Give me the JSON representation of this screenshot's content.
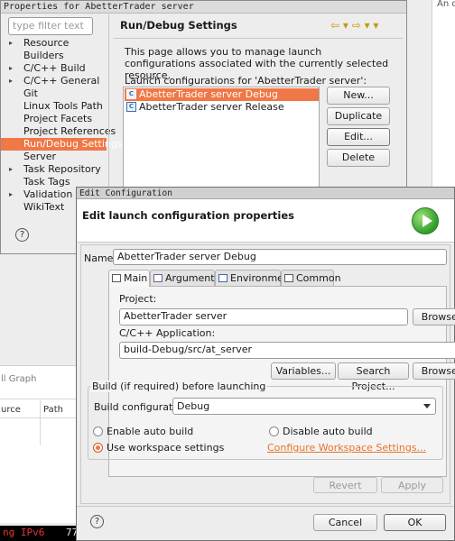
{
  "background": {
    "right_panel_text": "An o",
    "bottom_panel": {
      "title": "ll Graph",
      "columns": [
        "urce",
        "Path"
      ]
    },
    "terminal_text": "ng IPv6",
    "terminal_num": "77"
  },
  "properties": {
    "window_title": "Properties for AbetterTrader server",
    "filter_placeholder": "type filter text",
    "tree": [
      {
        "label": "Resource",
        "expandable": true,
        "selected": false
      },
      {
        "label": "Builders",
        "expandable": false,
        "selected": false
      },
      {
        "label": "C/C++ Build",
        "expandable": true,
        "selected": false
      },
      {
        "label": "C/C++ General",
        "expandable": true,
        "selected": false
      },
      {
        "label": "Git",
        "expandable": false,
        "selected": false
      },
      {
        "label": "Linux Tools Path",
        "expandable": false,
        "selected": false
      },
      {
        "label": "Project Facets",
        "expandable": false,
        "selected": false
      },
      {
        "label": "Project References",
        "expandable": false,
        "selected": false
      },
      {
        "label": "Run/Debug Settings",
        "expandable": false,
        "selected": true
      },
      {
        "label": "Server",
        "expandable": false,
        "selected": false
      },
      {
        "label": "Task Repository",
        "expandable": true,
        "selected": false
      },
      {
        "label": "Task Tags",
        "expandable": false,
        "selected": false
      },
      {
        "label": "Validation",
        "expandable": true,
        "selected": false
      },
      {
        "label": "WikiText",
        "expandable": false,
        "selected": false
      }
    ],
    "page_title": "Run/Debug Settings",
    "description": "This page allows you to manage launch configurations associated with the currently selected resource.",
    "launch_label": "Launch configurations for 'AbetterTrader server':",
    "configurations": [
      {
        "label": "AbetterTrader server Debug",
        "selected": true
      },
      {
        "label": "AbetterTrader server Release",
        "selected": false
      }
    ],
    "buttons": {
      "new": "New...",
      "duplicate": "Duplicate",
      "edit": "Edit...",
      "delete": "Delete"
    },
    "nav_icons": "⇦ ▾ ⇨ ▾ ▾"
  },
  "edit_dialog": {
    "window_title": "Edit Configuration",
    "header_title": "Edit launch configuration properties",
    "name_label": "Name:",
    "name_value": "AbetterTrader server Debug",
    "tabs": [
      "Main",
      "Arguments",
      "Environment",
      "Common"
    ],
    "active_tab": "Main",
    "project_label": "Project:",
    "project_value": "AbetterTrader server",
    "browse_label": "Browse...",
    "app_label": "C/C++ Application:",
    "app_value": "build-Debug/src/at_server",
    "variables_label": "Variables...",
    "search_project_label": "Search Project...",
    "build_group_title": "Build (if required) before launching",
    "build_config_label": "Build configuration:",
    "build_config_value": "Debug",
    "radio_enable_auto": "Enable auto build",
    "radio_disable_auto": "Disable auto build",
    "radio_workspace": "Use workspace settings",
    "selected_radio": "workspace",
    "configure_link": "Configure Workspace Settings...",
    "revert_label": "Revert",
    "apply_label": "Apply",
    "cancel_label": "Cancel",
    "ok_label": "OK",
    "colors": {
      "accent": "#f07746",
      "link": "#e8722a",
      "run_icon": "#2e9e2a"
    }
  }
}
